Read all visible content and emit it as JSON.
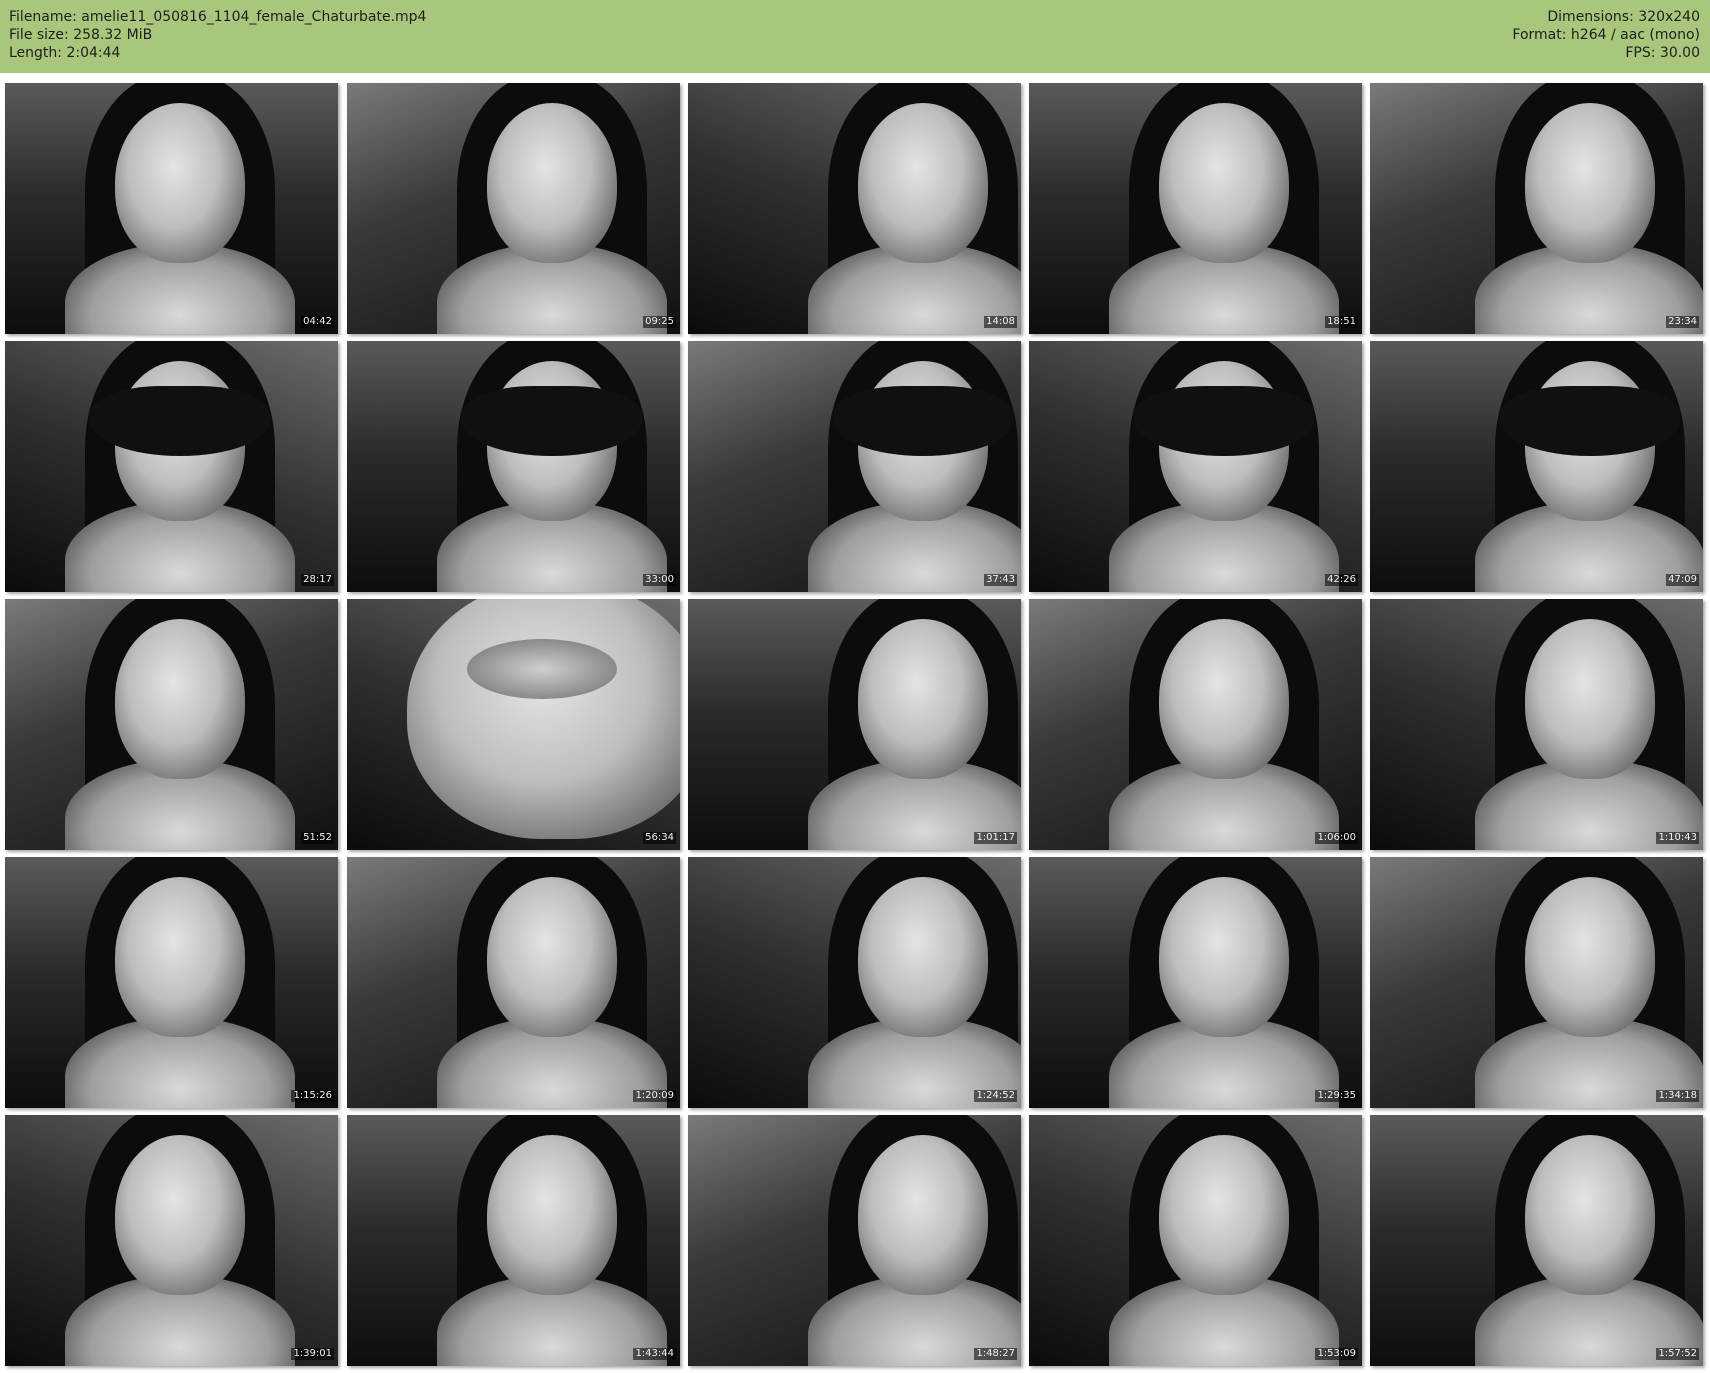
{
  "header": {
    "filename_line": "Filename: amelie11_050816_1104_female_Chaturbate.mp4",
    "filesize_line": "File size: 258.32 MiB",
    "length_line": "Length: 2:04:44",
    "dimensions_line": "Dimensions: 320x240",
    "format_line": "Format: h264 / aac (mono)",
    "fps_line": "FPS: 30.00",
    "bg_color": "#a9c77c"
  },
  "thumbnails": [
    {
      "time": "04:42",
      "scene": "face"
    },
    {
      "time": "09:25",
      "scene": "face"
    },
    {
      "time": "14:08",
      "scene": "face"
    },
    {
      "time": "18:51",
      "scene": "face"
    },
    {
      "time": "23:34",
      "scene": "face"
    },
    {
      "time": "28:17",
      "scene": "mask"
    },
    {
      "time": "33:00",
      "scene": "mask"
    },
    {
      "time": "37:43",
      "scene": "mask"
    },
    {
      "time": "42:26",
      "scene": "mask"
    },
    {
      "time": "47:09",
      "scene": "mask"
    },
    {
      "time": "51:52",
      "scene": "face"
    },
    {
      "time": "56:34",
      "scene": "lips"
    },
    {
      "time": "1:01:17",
      "scene": "face"
    },
    {
      "time": "1:06:00",
      "scene": "face"
    },
    {
      "time": "1:10:43",
      "scene": "face"
    },
    {
      "time": "1:15:26",
      "scene": "face"
    },
    {
      "time": "1:20:09",
      "scene": "face"
    },
    {
      "time": "1:24:52",
      "scene": "face"
    },
    {
      "time": "1:29:35",
      "scene": "face"
    },
    {
      "time": "1:34:18",
      "scene": "face"
    },
    {
      "time": "1:39:01",
      "scene": "face"
    },
    {
      "time": "1:43:44",
      "scene": "face"
    },
    {
      "time": "1:48:27",
      "scene": "face"
    },
    {
      "time": "1:53:09",
      "scene": "face"
    },
    {
      "time": "1:57:52",
      "scene": "face"
    }
  ]
}
